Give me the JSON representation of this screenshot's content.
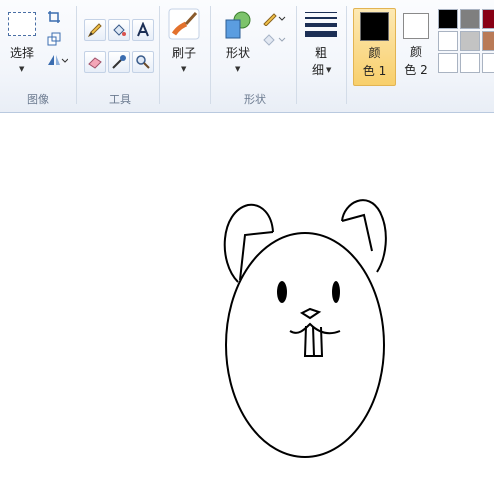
{
  "groups": {
    "image": {
      "label": "图像",
      "select_label": "选择"
    },
    "tools": {
      "label": "工具"
    },
    "brushes": {
      "label": "刷子"
    },
    "shapes": {
      "label": "形状",
      "shapes_label": "形状"
    },
    "size": {
      "label_line1": "粗",
      "label_line2": "细"
    },
    "color1": {
      "line1": "颜",
      "line2": "色 1"
    },
    "color2": {
      "line1": "颜",
      "line2": "色 2"
    }
  },
  "tool_icons": [
    "pencil-icon",
    "fill-bucket-icon",
    "text-icon",
    "eraser-icon",
    "color-picker-icon",
    "magnifier-icon"
  ],
  "palette": [
    "#000000",
    "#7f7f7f",
    "#880015",
    "#ffffff",
    "#c3c3c3",
    "#b97a57",
    "#ffffff",
    "#ffffff",
    "#ffffff"
  ],
  "colors": {
    "color1": "#000000",
    "color2": "#ffffff",
    "accent": "#f8cf6c"
  }
}
